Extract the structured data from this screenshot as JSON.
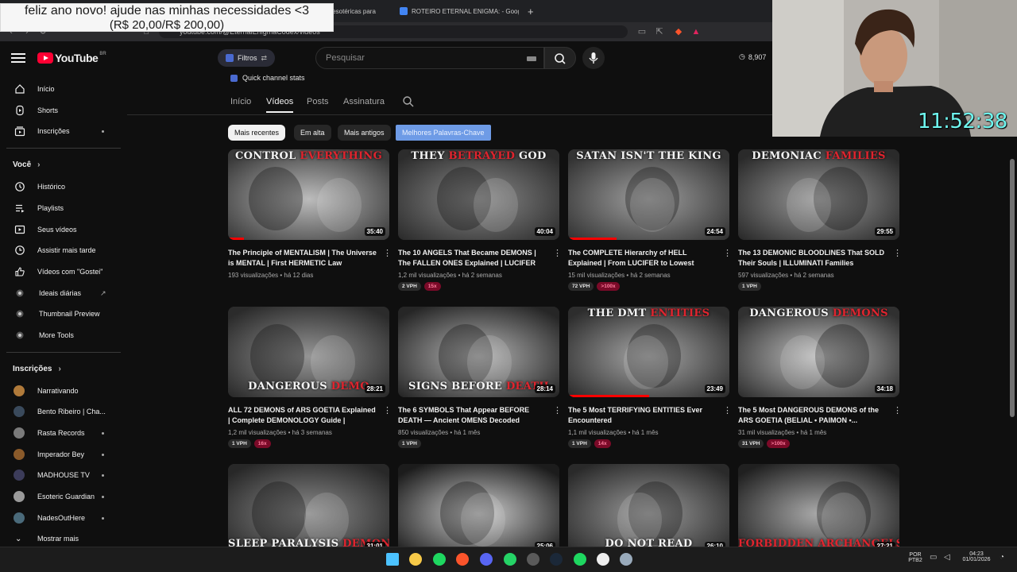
{
  "donation": {
    "line1": "feliz ano novo! ajude nas minhas necessidades <3",
    "line2": "(R$ 20,00/R$ 200,00)"
  },
  "browser": {
    "tabs": [
      {
        "label": "s esotéricas para",
        "color": "#555"
      },
      {
        "label": "ROTEIRO ETERNAL ENIGMA: - Googl",
        "color": "#4285f4"
      }
    ],
    "new_tab_label": "+",
    "url": "youtube.com/@EternalEnigmaCodex/videos"
  },
  "yt": {
    "logo_word": "YouTube",
    "country": "BR",
    "filters_label": "Filtros",
    "search_placeholder": "Pesquisar",
    "views_counter": "8,907"
  },
  "sidebar": {
    "main": [
      {
        "label": "Início",
        "icon": "home-icon"
      },
      {
        "label": "Shorts",
        "icon": "shorts-icon"
      },
      {
        "label": "Inscrições",
        "icon": "subscriptions-icon",
        "dot": true
      }
    ],
    "you_heading": "Você",
    "you": [
      {
        "label": "Histórico",
        "icon": "history-icon"
      },
      {
        "label": "Playlists",
        "icon": "playlists-icon"
      },
      {
        "label": "Seus vídeos",
        "icon": "your-videos-icon"
      },
      {
        "label": "Assistir mais tarde",
        "icon": "watch-later-icon"
      },
      {
        "label": "Vídeos com \"Gostei\"",
        "icon": "like-icon"
      },
      {
        "label": "Ideais diárias",
        "icon": "ideas-icon",
        "external": true
      },
      {
        "label": "Thumbnail Preview",
        "icon": "thumbnail-preview-icon"
      },
      {
        "label": "More Tools",
        "icon": "more-tools-icon"
      }
    ],
    "subs_heading": "Inscrições",
    "subs": [
      {
        "label": "Narrativando",
        "color": "#b07a3a",
        "dot": false
      },
      {
        "label": "Bento Ribeiro | Cha...",
        "color": "#3a4a5c",
        "dot": false
      },
      {
        "label": "Rasta Records",
        "color": "#7a7a7a",
        "dot": true
      },
      {
        "label": "Imperador Bey",
        "color": "#8a5a2a",
        "dot": true
      },
      {
        "label": "MADHOUSE TV",
        "color": "#3c3c5a",
        "dot": true
      },
      {
        "label": "Esoteric Guardian",
        "color": "#9a9a9a",
        "dot": true
      },
      {
        "label": "NadesOutHere",
        "color": "#4a6a7a",
        "dot": true
      }
    ],
    "show_more": "Mostrar mais"
  },
  "channel": {
    "quick_stats": "Quick channel stats",
    "tabs": [
      "Início",
      "Vídeos",
      "Posts",
      "Assinatura"
    ],
    "active_tab": "Vídeos",
    "chips": [
      "Mais recentes",
      "Em alta",
      "Mais antigos",
      "Melhores Palavras-Chave"
    ]
  },
  "videos": [
    {
      "thumb_pre": "CONTROL ",
      "thumb_red": "EVERYTHING",
      "thumb_post": "",
      "thumb_pos": "top",
      "duration": "35:40",
      "progress": 0.1,
      "title": "The Principle of MENTALISM | The Universe is MENTAL | First HERMETIC Law EXPOSE...",
      "views": "193 visualizações",
      "age": "há 12 dias",
      "vph": "",
      "hot": ""
    },
    {
      "thumb_pre": "THEY ",
      "thumb_red": "BETRAYED",
      "thumb_post": " GOD",
      "thumb_pos": "top",
      "duration": "40:04",
      "progress": 0,
      "title": "The 10 ANGELS That Became DEMONS | The FALLEN ONES Explained | LUCIFER to...",
      "views": "1,2 mil visualizações",
      "age": "há 2 semanas",
      "vph": "2 VPH",
      "hot": "15x"
    },
    {
      "thumb_pre": "SATAN",
      "thumb_red": "",
      "thumb_post": " ISN'T THE KING",
      "thumb_pos": "top",
      "duration": "24:54",
      "progress": 0.3,
      "title": "The COMPLETE Hierarchy of HELL Explained | From LUCIFER to Lowest DEMON |...",
      "views": "15 mil visualizações",
      "age": "há 2 semanas",
      "vph": "72 VPH",
      "hot": ">100x"
    },
    {
      "thumb_pre": "DEMONIAC ",
      "thumb_red": "FAMILIES",
      "thumb_post": "",
      "thumb_pos": "top",
      "duration": "29:55",
      "progress": 0,
      "title": "The 13 DEMONIC BLOODLINES That SOLD Their Souls | ILLUMINATI Families EXPOSE...",
      "views": "597 visualizações",
      "age": "há 2 semanas",
      "vph": "1 VPH",
      "hot": ""
    },
    {
      "thumb_pre": "DANGEROUS ",
      "thumb_red": "DEMO",
      "thumb_post": "",
      "thumb_pos": "bottom",
      "duration": "28:21",
      "progress": 0,
      "title": "ALL 72 DEMONS of ARS GOETIA Explained | Complete DEMONOLOGY Guide | OCCULT...",
      "views": "1,2 mil visualizações",
      "age": "há 3 semanas",
      "vph": "1 VPH",
      "hot": "16x"
    },
    {
      "thumb_pre": "SIGNS BEFORE ",
      "thumb_red": "DEATH",
      "thumb_post": "",
      "thumb_pos": "bottom",
      "duration": "28:14",
      "progress": 0,
      "title": "The 6 SYMBOLS That Appear BEFORE DEATH — Ancient OMENS Decoded",
      "views": "850 visualizações",
      "age": "há 1 mês",
      "vph": "1 VPH",
      "hot": ""
    },
    {
      "thumb_pre": "THE DMT ",
      "thumb_red": "ENTITIES",
      "thumb_post": "",
      "thumb_pos": "top",
      "duration": "23:49",
      "progress": 0.5,
      "title": "The 5 Most TERRIFYING ENTITIES Ever Encountered",
      "views": "1,1 mil visualizações",
      "age": "há 1 mês",
      "vph": "1 VPH",
      "hot": "14x"
    },
    {
      "thumb_pre": "DANGEROUS ",
      "thumb_red": "DEMONS",
      "thumb_post": "",
      "thumb_pos": "top",
      "duration": "34:18",
      "progress": 0,
      "title": "The 5 Most DANGEROUS DEMONS of the ARS GOETIA (BELIAL • PAIMON •...",
      "views": "31 mil visualizações",
      "age": "há 1 mês",
      "vph": "31 VPH",
      "hot": ">100x"
    },
    {
      "thumb_pre": "SLEEP PARALYSIS ",
      "thumb_red": "DEMONS",
      "thumb_post": "",
      "thumb_pos": "bottom",
      "duration": "31:01",
      "progress": 0,
      "title": "",
      "views": "",
      "age": "",
      "vph": "",
      "hot": ""
    },
    {
      "thumb_pre": "",
      "thumb_red": "",
      "thumb_post": "",
      "thumb_pos": "bottom",
      "duration": "25:06",
      "progress": 0,
      "title": "",
      "views": "",
      "age": "",
      "vph": "",
      "hot": ""
    },
    {
      "thumb_pre": "DO NOT READ",
      "thumb_red": "",
      "thumb_post": "",
      "thumb_pos": "bottom",
      "duration": "26:10",
      "progress": 0,
      "title": "",
      "views": "",
      "age": "",
      "vph": "",
      "hot": ""
    },
    {
      "thumb_pre": "",
      "thumb_red": "FORBIDDEN ARCHANGELS",
      "thumb_post": "",
      "thumb_pos": "bottom",
      "duration": "27:21",
      "progress": 0,
      "title": "",
      "views": "",
      "age": "",
      "vph": "",
      "hot": ""
    }
  ],
  "overlay": {
    "clock": "11:52:38"
  },
  "taskbar": {
    "apps": [
      {
        "name": "windows-start-icon",
        "color": "#4cc2ff"
      },
      {
        "name": "file-explorer-icon",
        "color": "#f7c948"
      },
      {
        "name": "spotify-icon",
        "color": "#1ed760"
      },
      {
        "name": "brave-browser-icon",
        "color": "#fb542b"
      },
      {
        "name": "discord-icon",
        "color": "#5865f2"
      },
      {
        "name": "whatsapp-icon",
        "color": "#25d366"
      },
      {
        "name": "obs-icon",
        "color": "#5a5a5a"
      },
      {
        "name": "steam-icon",
        "color": "#1b2838"
      },
      {
        "name": "spotify-alt-icon",
        "color": "#1ed760"
      },
      {
        "name": "capcut-icon",
        "color": "#eeeeee"
      },
      {
        "name": "notepad-icon",
        "color": "#9ab"
      }
    ],
    "lang1": "POR",
    "lang2": "PTB2",
    "time": "04:23",
    "date": "01/01/2026"
  }
}
